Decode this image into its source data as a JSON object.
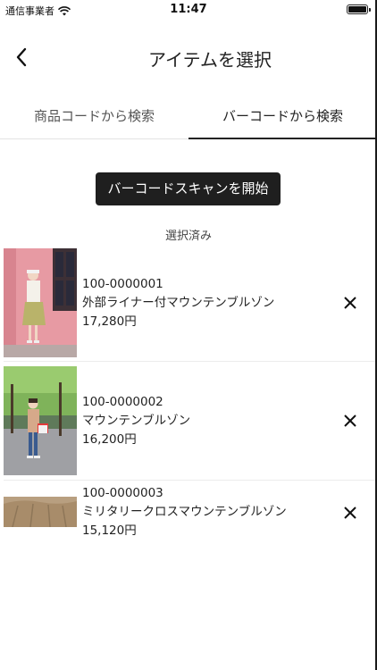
{
  "status_bar": {
    "carrier": "通信事業者",
    "time": "11:47"
  },
  "nav": {
    "title": "アイテムを選択",
    "back_icon": "chevron-left-icon"
  },
  "tabs": [
    {
      "label": "商品コードから検索",
      "active": false
    },
    {
      "label": "バーコードから検索",
      "active": true
    }
  ],
  "scan_button": {
    "label": "バーコードスキャンを開始"
  },
  "selected_section": {
    "label": "選択済み"
  },
  "items": [
    {
      "code": "100-0000001",
      "name": "外部ライナー付マウンテンブルゾン",
      "price": "17,280円"
    },
    {
      "code": "100-0000002",
      "name": "マウンテンブルゾン",
      "price": "16,200円"
    },
    {
      "code": "100-0000003",
      "name": "ミリタリークロスマウンテンブルゾン",
      "price": "15,120円"
    }
  ],
  "colors": {
    "accent": "#1f1f1f",
    "text": "#222222"
  }
}
